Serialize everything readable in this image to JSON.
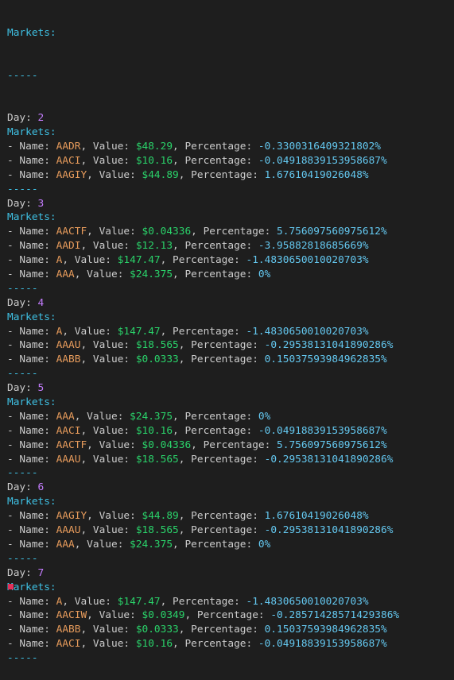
{
  "terminal": {
    "header": "Markets:",
    "separator": "-----",
    "day_label": "Day: ",
    "markets_label": "Markets:",
    "name_prefix": "- Name: ",
    "value_sep": ", Value: ",
    "pct_sep": ", Percentage: ",
    "days": [
      {
        "day": "2",
        "markets": [
          {
            "name": "AADR",
            "value": "$48.29",
            "percentage": "-0.3300316409321802%"
          },
          {
            "name": "AACI",
            "value": "$10.16",
            "percentage": "-0.04918839153958687%"
          },
          {
            "name": "AAGIY",
            "value": "$44.89",
            "percentage": "1.67610419026048%"
          }
        ]
      },
      {
        "day": "3",
        "markets": [
          {
            "name": "AACTF",
            "value": "$0.04336",
            "percentage": "5.756097560975612%"
          },
          {
            "name": "AADI",
            "value": "$12.13",
            "percentage": "-3.95882818685669%"
          },
          {
            "name": "A",
            "value": "$147.47",
            "percentage": "-1.4830650010020703%"
          },
          {
            "name": "AAA",
            "value": "$24.375",
            "percentage": "0%"
          }
        ]
      },
      {
        "day": "4",
        "markets": [
          {
            "name": "A",
            "value": "$147.47",
            "percentage": "-1.4830650010020703%"
          },
          {
            "name": "AAAU",
            "value": "$18.565",
            "percentage": "-0.29538131041890286%"
          },
          {
            "name": "AABB",
            "value": "$0.0333",
            "percentage": "0.15037593984962835%"
          }
        ]
      },
      {
        "day": "5",
        "markets": [
          {
            "name": "AAA",
            "value": "$24.375",
            "percentage": "0%"
          },
          {
            "name": "AACI",
            "value": "$10.16",
            "percentage": "-0.04918839153958687%"
          },
          {
            "name": "AACTF",
            "value": "$0.04336",
            "percentage": "5.756097560975612%"
          },
          {
            "name": "AAAU",
            "value": "$18.565",
            "percentage": "-0.29538131041890286%"
          }
        ]
      },
      {
        "day": "6",
        "markets": [
          {
            "name": "AAGIY",
            "value": "$44.89",
            "percentage": "1.67610419026048%"
          },
          {
            "name": "AAAU",
            "value": "$18.565",
            "percentage": "-0.29538131041890286%"
          },
          {
            "name": "AAA",
            "value": "$24.375",
            "percentage": "0%"
          }
        ]
      },
      {
        "day": "7",
        "markets": [
          {
            "name": "A",
            "value": "$147.47",
            "percentage": "-1.4830650010020703%"
          },
          {
            "name": "AACIW",
            "value": "$0.0349",
            "percentage": "-0.28571428571429386%"
          },
          {
            "name": "AABB",
            "value": "$0.0333",
            "percentage": "0.15037593984962835%"
          },
          {
            "name": "AACI",
            "value": "$10.16",
            "percentage": "-0.04918839153958687%"
          }
        ]
      }
    ]
  }
}
